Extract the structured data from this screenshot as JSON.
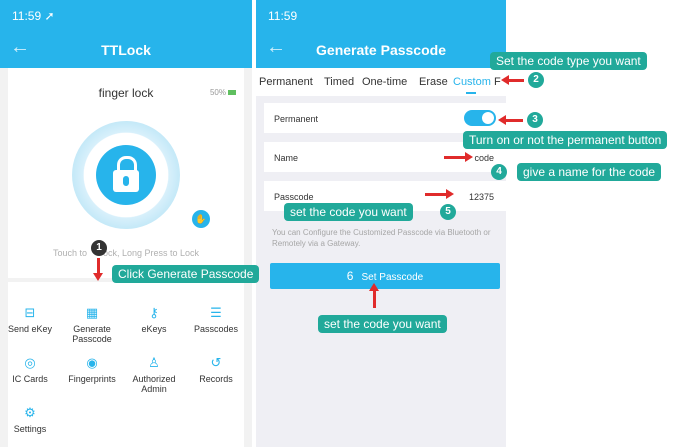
{
  "left": {
    "status_time": "11:59 ➚",
    "nav_title": "TTLock",
    "lock_name": "finger lock",
    "battery": "50%",
    "hint_prefix": "Touch to",
    "hint_suffix": "ock, Long Press to Lock",
    "menu": [
      {
        "icon": "⊟",
        "label": "Send eKey"
      },
      {
        "icon": "▦",
        "label": "Generate Passcode"
      },
      {
        "icon": "⚷",
        "label": "eKeys"
      },
      {
        "icon": "☰",
        "label": "Passcodes"
      },
      {
        "icon": "◎",
        "label": "IC Cards"
      },
      {
        "icon": "◉",
        "label": "Fingerprints"
      },
      {
        "icon": "♙",
        "label": "Authorized Admin"
      },
      {
        "icon": "↺",
        "label": "Records"
      },
      {
        "icon": "⚙",
        "label": "Settings"
      }
    ]
  },
  "right": {
    "status_time": "11:59",
    "nav_title": "Generate Passcode",
    "tabs": [
      "Permanent",
      "Timed",
      "One-time",
      "Erase",
      "Custom",
      "F"
    ],
    "active_tab": "Custom",
    "rows": {
      "permanent_label": "Permanent",
      "name_label": "Name",
      "name_value": "code",
      "passcode_label": "Passcode",
      "passcode_value": "12375"
    },
    "toggle_on": true,
    "info_text": "You can Configure the Customized Passcode via Bluetooth or Remotely via a Gateway.",
    "button_number": "6",
    "button_label": "Set Passcode"
  },
  "annotations": {
    "n1": "1",
    "c1": "Click Generate Passcode",
    "n2": "2",
    "c2": "Set the code type you want",
    "n3": "3",
    "c3": "Turn on or not the permanent button",
    "n4": "4",
    "c4": "give a name for the code",
    "n5": "5",
    "c5": "set the code you want",
    "c6": "set the code you want"
  },
  "colors": {
    "accent": "#27b4eb",
    "callout": "#21a99a",
    "arrow": "#e02b2b"
  }
}
